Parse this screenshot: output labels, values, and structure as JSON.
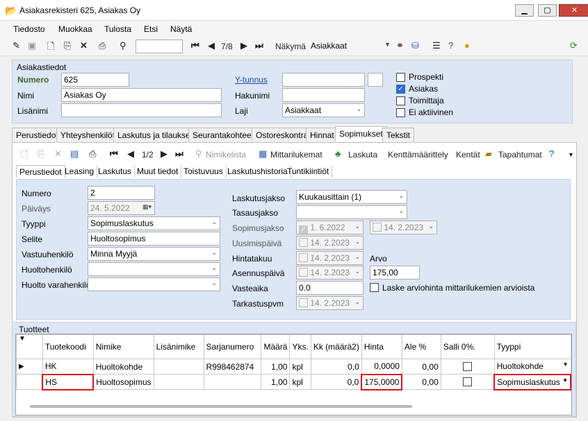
{
  "window": {
    "title": "Asiakasrekisteri 625, Asiakas Oy"
  },
  "menu": [
    "Tiedosto",
    "Muokkaa",
    "Tulosta",
    "Etsi",
    "Näytä"
  ],
  "toolbar": {
    "record_pos": "7/8",
    "view_label": "Näkymä",
    "view_value": "Asiakkaat"
  },
  "customer": {
    "group_title": "Asiakastiedot",
    "numero_label": "Numero",
    "numero_value": "625",
    "nimi_label": "Nimi",
    "nimi_value": "Asiakas Oy",
    "lisanimi_label": "Lisänimi",
    "lisanimi_value": "",
    "ytunnus_label": "Y-tunnus",
    "ytunnus_value": "",
    "hakunimi_label": "Hakunimi",
    "hakunimi_value": "",
    "laji_label": "Laji",
    "laji_value": "Asiakkaat",
    "checks": [
      {
        "label": "Prospekti",
        "checked": false
      },
      {
        "label": "Asiakas",
        "checked": true
      },
      {
        "label": "Toimittaja",
        "checked": false
      },
      {
        "label": "Ei aktiivinen",
        "checked": false
      }
    ]
  },
  "main_tabs": [
    "Perustiedot",
    "Yhteyshenkilöt",
    "Laskutus ja tilaukset",
    "Seurantakohteet",
    "Ostoreskontra",
    "Hinnat",
    "Sopimukset",
    "Tekstit"
  ],
  "sub_toolbar": {
    "record_pos": "1/2",
    "nimikelista": "Nimikelista",
    "mittarilukemat": "Mittarilukemat",
    "laskuta": "Laskuta",
    "kenttamaarittely": "Kenttämäärittely",
    "kentat": "Kentät",
    "tapahtumat": "Tapahtumat"
  },
  "sub_tabs": [
    "Perustiedot",
    "Leasing",
    "Laskutus",
    "Muut tiedot",
    "Toistuvuus",
    "Laskutushistoria",
    "Tuntikiintiöt"
  ],
  "contract": {
    "numero_label": "Numero",
    "numero_value": "2",
    "paivays_label": "Päiväys",
    "paivays_value": "24. 5.2022",
    "tyyppi_label": "Tyyppi",
    "tyyppi_value": "Sopimuslaskutus",
    "selite_label": "Selite",
    "selite_value": "Huoltosopimus",
    "vastuuhenkilo_label": "Vastuuhenkilö",
    "vastuuhenkilo_value": "Minna Myyjä",
    "huoltohenkilo_label": "Huoltohenkilö",
    "huoltohenkilo_value": "",
    "huolto_varahenkilo_label": "Huolto varahenkilö",
    "huolto_varahenkilo_value": "",
    "laskutusjakso_label": "Laskutusjakso",
    "laskutusjakso_value": "Kuukausittain (1)",
    "tasausjakso_label": "Tasausjakso",
    "tasausjakso_value": "",
    "sopimusjakso_label": "Sopimusjakso",
    "sopimusjakso_start": "1. 6.2022",
    "sopimusjakso_end": "14. 2.2023",
    "uusimispaiva_label": "Uusimispäivä",
    "uusimispaiva_value": "14. 2.2023",
    "hintatakuu_label": "Hintatakuu",
    "hintatakuu_value": "14. 2.2023",
    "asennuspaiva_label": "Asennuspäivä",
    "asennuspaiva_value": "14. 2.2023",
    "vasteaika_label": "Vasteaika",
    "vasteaika_value": "0.0",
    "tarkastuspvm_label": "Tarkastuspvm",
    "tarkastuspvm_value": "14. 2.2023",
    "arvo_label": "Arvo",
    "arvo_value": "175,00",
    "laske_label": "Laske arviohinta mittarilukemien arvioista"
  },
  "products": {
    "title": "Tuotteet",
    "columns": [
      "Tuotekoodi",
      "Nimike",
      "Lisänimike",
      "Sarjanumero",
      "Määrä",
      "Yks.",
      "Kk (määrä2)",
      "Hinta",
      "Ale %",
      "Salli 0%.",
      "Tyyppi"
    ],
    "rows": [
      [
        "HK",
        "Huoltokohde",
        "",
        "R998462874",
        "1,00",
        "kpl",
        "0,0",
        "0,0000",
        "0,00",
        "",
        "Huoltokohde"
      ],
      [
        "HS",
        "Huoltosopimus",
        "",
        "",
        "1,00",
        "kpl",
        "0,0",
        "175,0000",
        "0,00",
        "",
        "Sopimuslaskutus"
      ]
    ]
  }
}
